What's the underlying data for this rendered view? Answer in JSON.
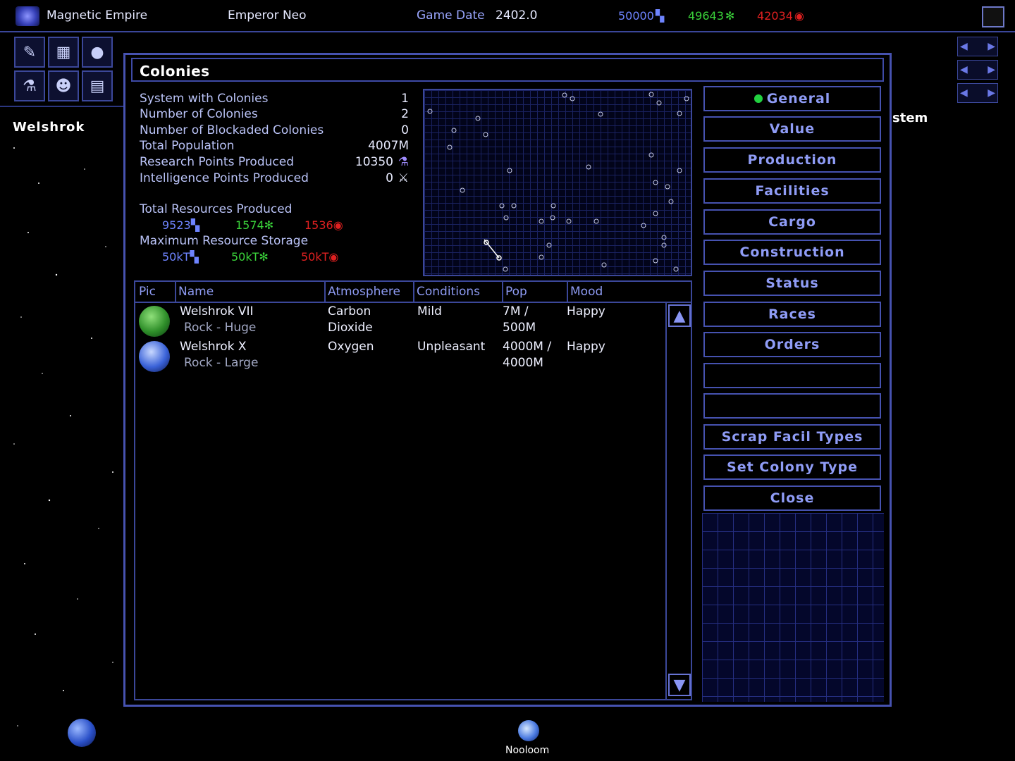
{
  "topbar": {
    "empire_name": "Magnetic Empire",
    "ruler": "Emperor Neo",
    "game_date_label": "Game Date",
    "game_date": "2402.0",
    "resources": [
      {
        "value": "50000",
        "color": "#6e84ff",
        "icon": "mineral-icon"
      },
      {
        "value": "49643",
        "color": "#3ad23a",
        "icon": "organics-icon"
      },
      {
        "value": "42034",
        "color": "#e02020",
        "icon": "radioactives-icon"
      }
    ]
  },
  "sidebar": {
    "system_name": "Welshrok",
    "right_label": "stem"
  },
  "dialog": {
    "title": "Colonies",
    "stats": [
      {
        "label": "System with Colonies",
        "value": "1"
      },
      {
        "label": "Number of Colonies",
        "value": "2"
      },
      {
        "label": "Number of Blockaded Colonies",
        "value": "0"
      },
      {
        "label": "Total Population",
        "value": "4007M"
      },
      {
        "label": "Research Points Produced",
        "value": "10350"
      },
      {
        "label": "Intelligence Points Produced",
        "value": "0"
      }
    ],
    "resources_produced_label": "Total Resources Produced",
    "resources_produced": [
      "9523",
      "1574",
      "1536"
    ],
    "max_storage_label": "Maximum Resource Storage",
    "max_storage": [
      "50kT",
      "50kT",
      "50kT"
    ],
    "table": {
      "headers": [
        "Pic",
        "Name",
        "Atmosphere",
        "Conditions",
        "Pop",
        "Mood"
      ],
      "rows": [
        {
          "name": "Welshrok VII",
          "type": "Rock - Huge",
          "atmosphere_1": "Carbon",
          "atmosphere_2": "Dioxide",
          "conditions": "Mild",
          "pop_1": "7M /",
          "pop_2": "500M",
          "mood": "Happy"
        },
        {
          "name": "Welshrok X",
          "type": "Rock - Large",
          "atmosphere_1": "Oxygen",
          "atmosphere_2": "",
          "conditions": "Unpleasant",
          "pop_1": "4000M /",
          "pop_2": "4000M",
          "mood": "Happy"
        }
      ]
    },
    "buttons": [
      "General",
      "Value",
      "Production",
      "Facilities",
      "Cargo",
      "Construction",
      "Status",
      "Races",
      "Orders",
      "Scrap Facil Types",
      "Set Colony Type",
      "Close"
    ]
  },
  "map_labels": {
    "bottom_planet": "Nooloom"
  }
}
